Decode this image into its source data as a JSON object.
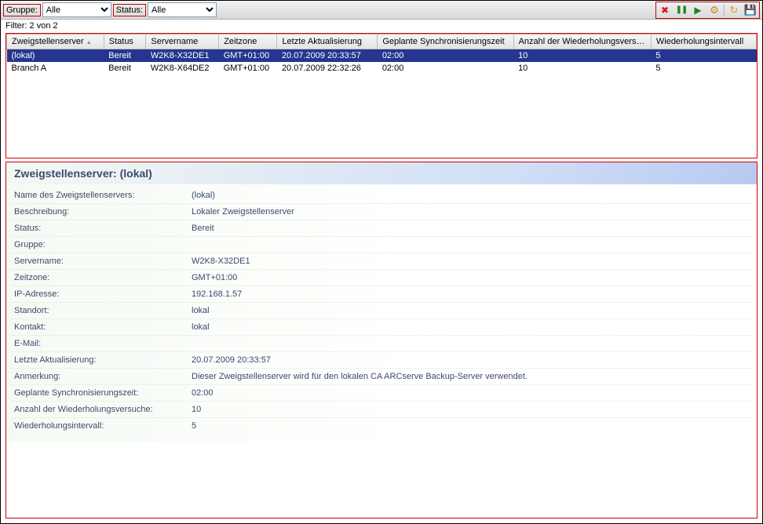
{
  "toolbar": {
    "group_label": "Gruppe:",
    "group_value": "Alle",
    "status_label": "Status:",
    "status_value": "Alle",
    "buttons": {
      "delete_icon": "✖",
      "pause_icon": "❚❚",
      "play_icon": "▶",
      "config_icon": "⚙",
      "refresh_icon": "↻",
      "save_icon": "💾"
    }
  },
  "filter_line": "Filter: 2 von 2",
  "grid": {
    "columns": [
      "Zweigstellenserver",
      "Status",
      "Servername",
      "Zeitzone",
      "Letzte Aktualisierung",
      "Geplante Synchronisierungszeit",
      "Anzahl der Wiederholungsversuche",
      "Wiederholungsintervall"
    ],
    "rows": [
      {
        "selected": true,
        "cells": [
          "(lokal)",
          "Bereit",
          "W2K8-X32DE1",
          "GMT+01:00",
          "20.07.2009 20:33:57",
          "02:00",
          "10",
          "5"
        ]
      },
      {
        "selected": false,
        "cells": [
          "Branch A",
          "Bereit",
          "W2K8-X64DE2",
          "GMT+01:00",
          "20.07.2009 22:32:26",
          "02:00",
          "10",
          "5"
        ]
      }
    ]
  },
  "detail": {
    "title": "Zweigstellenserver: (lokal)",
    "rows": [
      {
        "label": "Name des Zweigstellenservers:",
        "value": "(lokal)"
      },
      {
        "label": "Beschreibung:",
        "value": "Lokaler Zweigstellenserver"
      },
      {
        "label": "Status:",
        "value": "Bereit"
      },
      {
        "label": "Gruppe:",
        "value": ""
      },
      {
        "label": "Servername:",
        "value": "W2K8-X32DE1"
      },
      {
        "label": "Zeitzone:",
        "value": "GMT+01:00"
      },
      {
        "label": "IP-Adresse:",
        "value": "192.168.1.57"
      },
      {
        "label": "Standort:",
        "value": "lokal"
      },
      {
        "label": "Kontakt:",
        "value": "lokal"
      },
      {
        "label": "E-Mail:",
        "value": ""
      },
      {
        "label": "Letzte Aktualisierung:",
        "value": "20.07.2009 20:33:57"
      },
      {
        "label": "Anmerkung:",
        "value": "Dieser Zweigstellenserver wird für den lokalen CA ARCserve Backup-Server verwendet."
      },
      {
        "label": "Geplante Synchronisierungszeit:",
        "value": "02:00"
      },
      {
        "label": "Anzahl der Wiederholungsversuche:",
        "value": "10"
      },
      {
        "label": "Wiederholungsintervall:",
        "value": "5"
      }
    ]
  }
}
